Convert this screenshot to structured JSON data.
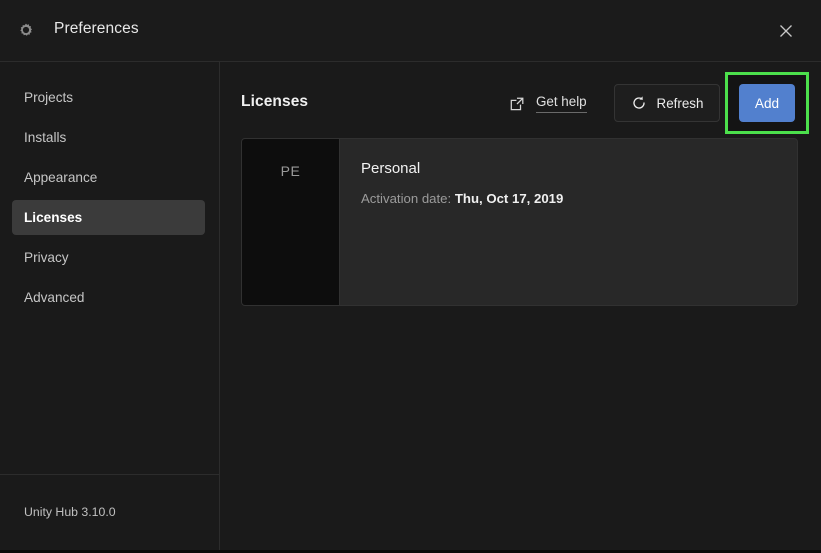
{
  "window": {
    "title": "Preferences",
    "gear_icon": "gear-icon",
    "close_icon": "close-icon"
  },
  "sidebar": {
    "items": [
      {
        "label": "Projects",
        "selected": false
      },
      {
        "label": "Installs",
        "selected": false
      },
      {
        "label": "Appearance",
        "selected": false
      },
      {
        "label": "Licenses",
        "selected": true
      },
      {
        "label": "Privacy",
        "selected": false
      },
      {
        "label": "Advanced",
        "selected": false
      }
    ],
    "footer": "Unity Hub 3.10.0"
  },
  "main": {
    "title": "Licenses",
    "get_help": {
      "label": "Get help",
      "icon": "external-link-icon"
    },
    "refresh": {
      "label": "Refresh",
      "icon": "refresh-icon"
    },
    "add": {
      "label": "Add",
      "highlighted": true,
      "highlight_color": "#4ce04c",
      "button_color": "#5280ce"
    },
    "licenses": [
      {
        "badge": "PE",
        "name": "Personal",
        "meta_label": "Activation date:",
        "meta_value": "Thu, Oct 17, 2019"
      }
    ]
  },
  "colors": {
    "background": "#1a1a1a",
    "sidebar_selected": "#3b3b3b",
    "card_background": "#282828",
    "badge_background": "#0d0d0d",
    "accent_blue": "#5280ce",
    "highlight_green": "#4ce04c",
    "divider": "#2c2c2c"
  }
}
